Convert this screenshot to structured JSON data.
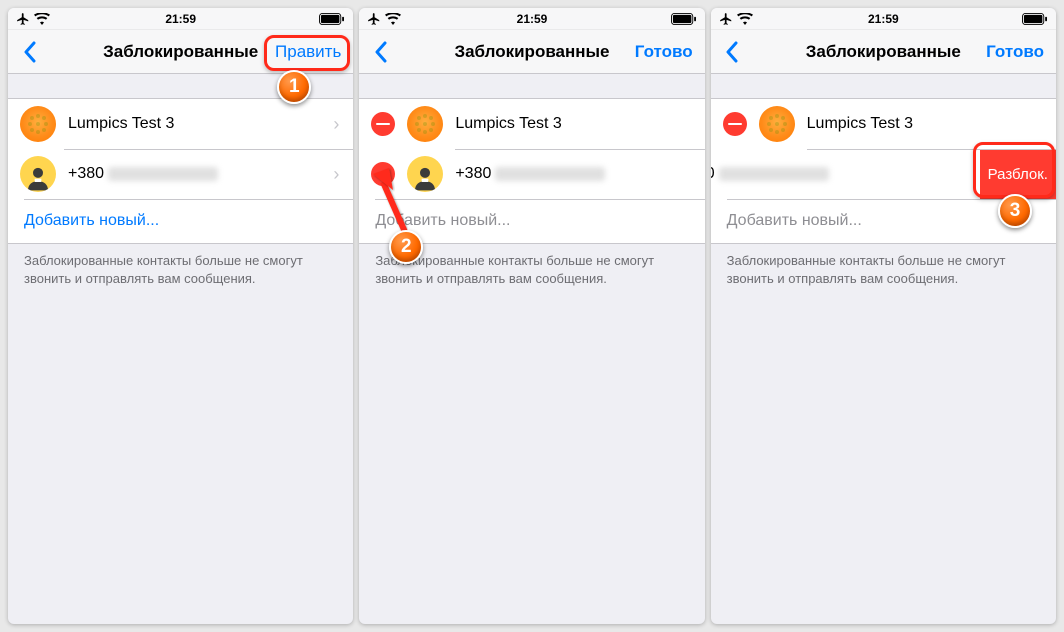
{
  "status": {
    "time": "21:59"
  },
  "titles": {
    "blocked": "Заблокированные",
    "blocked_trunc": "Заблокированные"
  },
  "actions": {
    "edit": "Править",
    "done": "Готово"
  },
  "contacts": {
    "c1": "Lumpics Test 3",
    "c2_prefix": "+380"
  },
  "add_new": "Добавить новый...",
  "footer": "Заблокированные контакты больше не смогут звонить и отправлять вам сообщения.",
  "unblock": "Разблок.",
  "steps": {
    "s1": "1",
    "s2": "2",
    "s3": "3"
  }
}
